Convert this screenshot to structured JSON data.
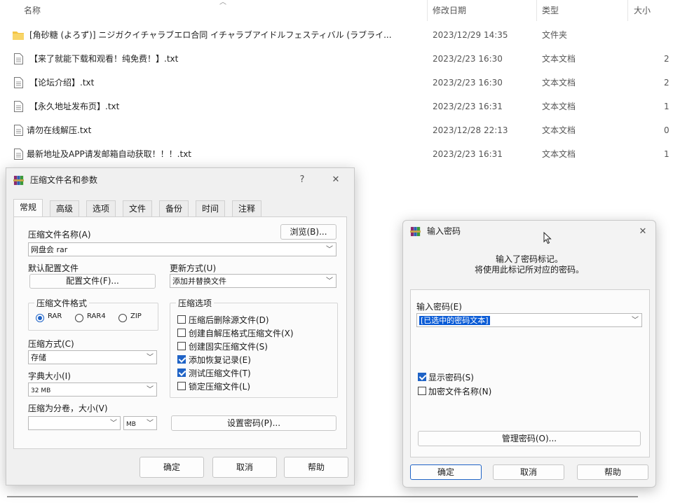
{
  "explorer": {
    "columns": {
      "name": "名称",
      "date": "修改日期",
      "type": "类型",
      "size": "大小"
    },
    "rows": [
      {
        "name": "[角砂糖 (よろず)] ニジガクイチャラブエロ合同 イチャラブアイドルフェスティバル (ラブライ...",
        "date": "2023/12/29 14:35",
        "type": "文件夹",
        "size": "",
        "icon": "folder-icon"
      },
      {
        "name": "【来了就能下载和观看！纯免费！】.txt",
        "date": "2023/2/23 16:30",
        "type": "文本文档",
        "size": "2",
        "icon": "text-file-icon"
      },
      {
        "name": "【论坛介绍】.txt",
        "date": "2023/2/23 16:30",
        "type": "文本文档",
        "size": "2",
        "icon": "text-file-icon"
      },
      {
        "name": "【永久地址发布页】.txt",
        "date": "2023/2/23 16:31",
        "type": "文本文档",
        "size": "1",
        "icon": "text-file-icon"
      },
      {
        "name": "请勿在线解压.txt",
        "date": "2023/12/28 22:13",
        "type": "文本文档",
        "size": "0",
        "icon": "text-file-icon"
      },
      {
        "name": "最新地址及APP请发邮箱自动获取！！！.txt",
        "date": "2023/2/23 16:31",
        "type": "文本文档",
        "size": "1",
        "icon": "text-file-icon"
      }
    ]
  },
  "archive_dialog": {
    "title": "压缩文件名和参数",
    "help": "?",
    "close": "✕",
    "tabs": [
      "常规",
      "高级",
      "选项",
      "文件",
      "备份",
      "时间",
      "注释"
    ],
    "archive_name_label": "压缩文件名称(A)",
    "browse_label": "浏览(B)...",
    "archive_name_value": "网盘会 rar",
    "profile_label": "默认配置文件",
    "profile_button": "配置文件(F)...",
    "update_label": "更新方式(U)",
    "update_value": "添加并替换文件",
    "format_label": "压缩文件格式",
    "formats": [
      "RAR",
      "RAR4",
      "ZIP"
    ],
    "options_label": "压缩选项",
    "options": [
      {
        "label": "压缩后删除源文件(D)",
        "checked": false
      },
      {
        "label": "创建自解压格式压缩文件(X)",
        "checked": false
      },
      {
        "label": "创建固实压缩文件(S)",
        "checked": false
      },
      {
        "label": "添加恢复记录(E)",
        "checked": true
      },
      {
        "label": "测试压缩文件(T)",
        "checked": true
      },
      {
        "label": "锁定压缩文件(L)",
        "checked": false
      }
    ],
    "method_label": "压缩方式(C)",
    "method_value": "存储",
    "dict_label": "字典大小(I)",
    "dict_value": "32 MB",
    "split_label": "压缩为分卷，大小(V)",
    "split_value": "",
    "split_unit": "MB",
    "set_password": "设置密码(P)...",
    "ok": "确定",
    "cancel": "取消",
    "help_btn": "帮助"
  },
  "password_dialog": {
    "title": "输入密码",
    "close": "✕",
    "message_line1": "输入了密码标记。",
    "message_line2": "将使用此标记所对应的密码。",
    "password_label": "输入密码(E)",
    "password_value": "[已选中的密码文本]",
    "show_password": "显示密码(S)",
    "encrypt_names": "加密文件名称(N)",
    "manage": "管理密码(O)...",
    "ok": "确定",
    "cancel": "取消",
    "help": "帮助"
  },
  "colors": {
    "accent": "#1f63c6",
    "selection": "#0a5bd6",
    "folder": "#f3c443"
  }
}
